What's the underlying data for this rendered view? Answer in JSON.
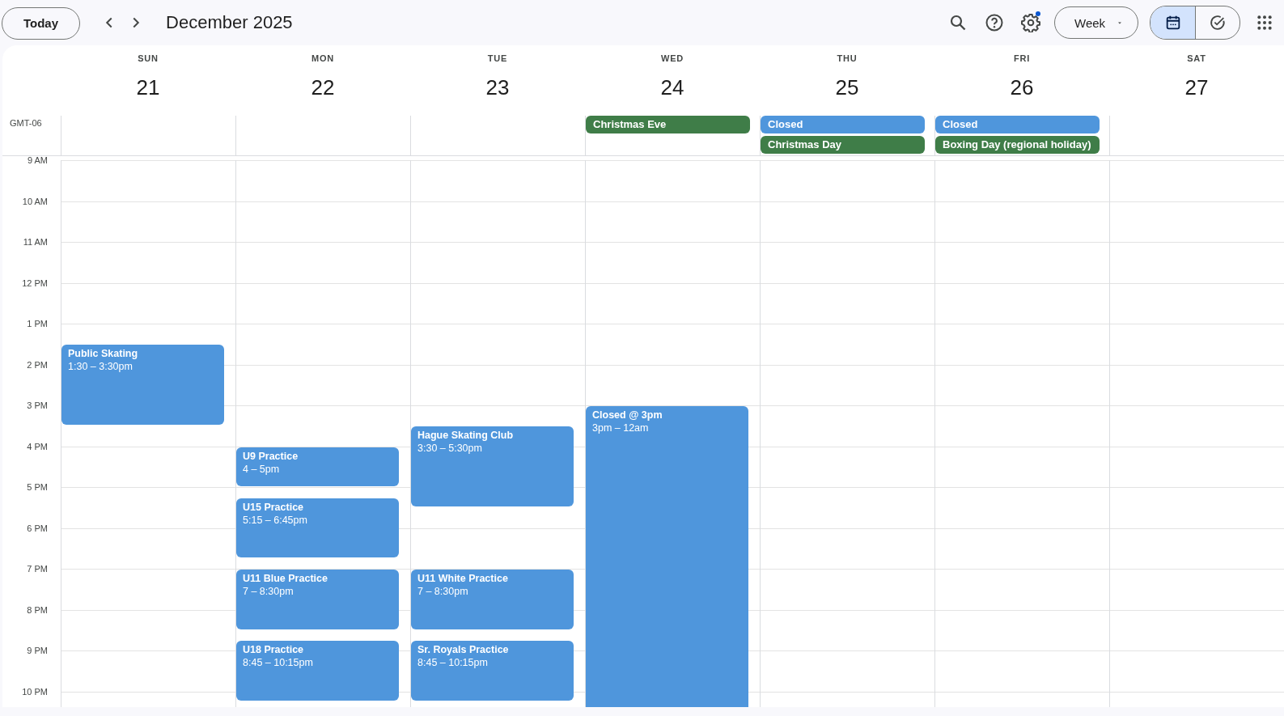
{
  "toolbar": {
    "today_button": "Today",
    "title": "December 2025",
    "settings_badge": true,
    "view_menu": "Week",
    "view_toggle": [
      {
        "kind": "calendar",
        "selected": true
      },
      {
        "kind": "tasks",
        "selected": false
      }
    ]
  },
  "timezone": "GMT-06",
  "hours": [
    "9 AM",
    "10 AM",
    "11 AM",
    "12 PM",
    "1 PM",
    "2 PM",
    "3 PM",
    "4 PM",
    "5 PM",
    "6 PM",
    "7 PM",
    "8 PM",
    "9 PM",
    "10 PM"
  ],
  "days": [
    {
      "name": "SUN",
      "date": "21",
      "events": [
        {
          "title": "Public Skating",
          "time": "1:30 – 3:30pm",
          "color": "#4f96dc"
        }
      ]
    },
    {
      "name": "MON",
      "date": "22",
      "events": [
        {
          "title": "U9 Practice",
          "time": "4 – 5pm",
          "color": "#4f96dc"
        },
        {
          "title": "U15 Practice",
          "time": "5:15 – 6:45pm",
          "color": "#4f96dc"
        },
        {
          "title": "U11 Blue Practice",
          "time": "7 – 8:30pm",
          "color": "#4f96dc"
        },
        {
          "title": "U18 Practice",
          "time": "8:45 – 10:15pm",
          "color": "#4f96dc"
        }
      ]
    },
    {
      "name": "TUE",
      "date": "23",
      "events": [
        {
          "title": "Hague Skating Club",
          "time": "3:30 – 5:30pm",
          "color": "#4f96dc"
        },
        {
          "title": "U11 White Practice",
          "time": "7 – 8:30pm",
          "color": "#4f96dc"
        },
        {
          "title": "Sr. Royals Practice",
          "time": "8:45 – 10:15pm",
          "color": "#4f96dc"
        }
      ]
    },
    {
      "name": "WED",
      "date": "24",
      "all_day": [
        {
          "title": "Christmas Eve",
          "color": "#3f7d48"
        }
      ],
      "events": [
        {
          "title": "Closed @ 3pm",
          "time": "3pm – 12am",
          "color": "#4f96dc"
        }
      ]
    },
    {
      "name": "THU",
      "date": "25",
      "all_day": [
        {
          "title": "Closed",
          "color": "#4f96dc"
        },
        {
          "title": "Christmas Day",
          "color": "#3f7d48"
        }
      ]
    },
    {
      "name": "FRI",
      "date": "26",
      "all_day": [
        {
          "title": "Closed",
          "color": "#4f96dc"
        },
        {
          "title": "Boxing Day (regional holiday)",
          "color": "#3f7d48"
        }
      ]
    },
    {
      "name": "SAT",
      "date": "27"
    }
  ]
}
